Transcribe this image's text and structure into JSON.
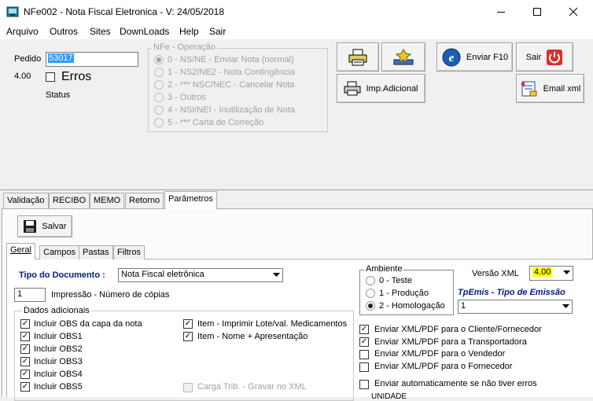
{
  "window": {
    "title": "NFe002 - Nota Fiscal Eletronica - V: 24/05/2018"
  },
  "menu": [
    "Arquivo",
    "Outros",
    "Sites",
    "DownLoads",
    "Help",
    "Sair"
  ],
  "top": {
    "pedido_label": "Pedido",
    "pedido_value": "53017",
    "version_label": "4.00",
    "erros_label": "Erros",
    "status_label": "Status"
  },
  "operacao": {
    "legend": "NFe - Operação",
    "options": [
      "0 - NS/NE - Enviar Nota (normal)",
      "1 - NS2/NE2 - Nota Contingência",
      "2 - *** NSC/NEC - Cancelar Nota",
      "3 - Outros",
      "4 - NSI/NEI - Inutilização de Nota",
      "5 - *** Carta de Correção"
    ],
    "selected": 0
  },
  "buttons": {
    "enviar": "Enviar F10",
    "sair": "Sair",
    "imp_adicional": "Imp.Adicional",
    "email_xml": "Email xml",
    "salvar": "Salvar"
  },
  "tabs": [
    "Validação",
    "RECIBO",
    "MEMO",
    "Retorno",
    "Parâmetros"
  ],
  "active_tab": "Parâmetros",
  "subtabs": [
    "Geral",
    "Campos",
    "Pastas",
    "Filtros"
  ],
  "active_subtab": "Geral",
  "geral": {
    "tipo_documento_label": "Tipo do Documento :",
    "tipo_documento_value": "Nota Fiscal eletrônica",
    "copias_value": "1",
    "copias_label": "Impressão - Número de cópias",
    "dados_adicionais_legend": "Dados adicionais",
    "left_checks": [
      {
        "label": "Incluir OBS da capa da nota",
        "checked": true
      },
      {
        "label": "Incluir OBS1",
        "checked": true
      },
      {
        "label": "Incluir OBS2",
        "checked": true
      },
      {
        "label": "Incluir OBS3",
        "checked": true
      },
      {
        "label": "Incluir OBS4",
        "checked": true
      },
      {
        "label": "Incluir OBS5",
        "checked": true
      }
    ],
    "right_checks": [
      {
        "label": "Item - Imprimir Lote/val. Medicamentos",
        "checked": true
      },
      {
        "label": "Item - Nome + Apresentação",
        "checked": true
      }
    ],
    "carga_trib_label": "Carga Trib. - Gravar no XML",
    "ambiente_legend": "Ambiente",
    "ambiente_options": [
      "0 - Teste",
      "1 - Produção",
      "2 - Homologação"
    ],
    "ambiente_selected": 2,
    "versao_xml_label": "Versão XML",
    "versao_xml_value": "4.00",
    "tpemis_label": "TpEmis - Tipo de Emissão",
    "tpemis_value": "1",
    "envio_checks": [
      {
        "label": "Enviar XML/PDF para o Cliente/Fornecedor",
        "checked": true
      },
      {
        "label": "Enviar XML/PDF para a Transportadora",
        "checked": true
      },
      {
        "label": "Enviar XML/PDF para o Vendedor",
        "checked": false
      },
      {
        "label": "Enviar XML/PDF para o Fornecedor",
        "checked": false
      }
    ],
    "auto_envio_label": "Enviar automaticamente se não tiver erros",
    "unidade_label": "UNIDADE"
  },
  "colors": {
    "selection": "#3399ff",
    "highlight": "#ffff00",
    "label_blue": "#002080"
  }
}
